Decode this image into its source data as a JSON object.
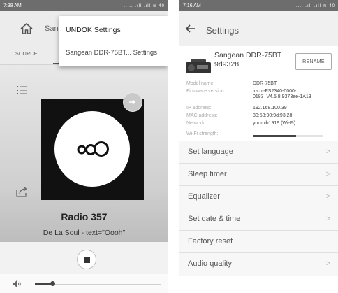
{
  "left": {
    "status": {
      "time": "7:38 AM",
      "signals": "..... .ıll .ıll ≋ 40"
    },
    "topbar": {
      "name": "Sang"
    },
    "tabs": {
      "source": "SOURCE"
    },
    "popup": {
      "title": "UNDOK Settings",
      "item": "Sangean  DDR-75BT... Settings"
    },
    "player": {
      "station": "Radio 357",
      "now_playing": "De La Soul - text=\"Oooh\""
    },
    "volume": {
      "level_fraction": 0.14
    }
  },
  "right": {
    "status": {
      "time": "7:16 AM",
      "signals": ".... .ıll .ıll ≋ 40"
    },
    "header": {
      "title": "Settings"
    },
    "device": {
      "name": "Sangean  DDR-75BT 9d9328",
      "rename": "RENAME"
    },
    "info": [
      {
        "label": "Model name:",
        "value": "DDR-75BT"
      },
      {
        "label": "Firmware version:",
        "value": "ir-cui-FS2340-0000-0183_V4.5.8.9373ee-1A13"
      },
      {
        "label": "IP address:",
        "value": "192.168.100.39"
      },
      {
        "label": "MAC address:",
        "value": "30:58:90:9d:93:28"
      },
      {
        "label": "Network:",
        "value": "youmib1919 (Wi-Fi)"
      },
      {
        "label": "Wi-Fi strength:",
        "value": ""
      }
    ],
    "wifi_strength_fraction": 0.62,
    "menu": [
      {
        "label": "Set language",
        "chevron": ">"
      },
      {
        "label": "Sleep timer",
        "chevron": ">"
      },
      {
        "label": "Equalizer",
        "chevron": ">"
      },
      {
        "label": "Set date & time",
        "chevron": ">"
      },
      {
        "label": "Factory reset",
        "chevron": ""
      },
      {
        "label": "Audio quality",
        "chevron": ">"
      }
    ]
  }
}
